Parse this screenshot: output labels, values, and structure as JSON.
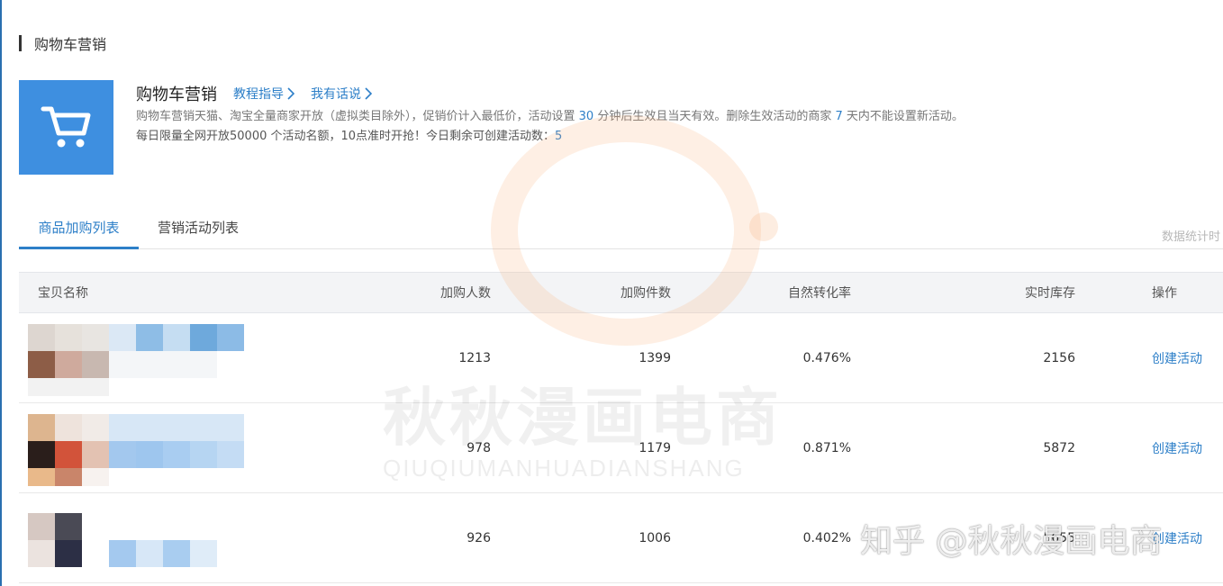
{
  "section": {
    "title": "购物车营销"
  },
  "intro": {
    "title": "购物车营销",
    "links": [
      "教程指导",
      "我有话说"
    ],
    "desc_1": "购物车营销天猫、淘宝全量商家开放（虚拟类目除外），促销价计入最低价，活动设置",
    "desc_num_1": "30",
    "desc_2": "分钟后生效且当天有效。删除生效活动的商家",
    "desc_num_2": "7",
    "desc_3": "天内不能设置新活动。",
    "quota_text": "每日限量全网开放50000 个活动名额，10点准时开抢！今日剩余可创建活动数：",
    "quota_value": "5"
  },
  "tabs": [
    {
      "label": "商品加购列表",
      "active": true
    },
    {
      "label": "营销活动列表",
      "active": false
    }
  ],
  "stat_note": "数据统计时",
  "table": {
    "headers": [
      "宝贝名称",
      "加购人数",
      "加购件数",
      "自然转化率",
      "实时库存",
      "操作"
    ],
    "rows": [
      {
        "buyers": "1213",
        "items": "1399",
        "rate": "0.476%",
        "stock": "2156",
        "action": "创建活动"
      },
      {
        "buyers": "978",
        "items": "1179",
        "rate": "0.871%",
        "stock": "5872",
        "action": "创建活动"
      },
      {
        "buyers": "926",
        "items": "1006",
        "rate": "0.402%",
        "stock": "5655",
        "action": "创建活动"
      }
    ]
  },
  "watermark": {
    "cn": "秋秋漫画电商",
    "en": "QIUQIUMANHUADIANSHANG",
    "zhihu": "知乎 @秋秋漫画电商"
  },
  "colors": {
    "accent": "#2d7fc8",
    "tile": "#3e8fe0",
    "header_bg": "#f3f4f6"
  },
  "icons": {
    "cart": "shopping-cart-icon",
    "link_arrow": "chevron-right-icon"
  }
}
